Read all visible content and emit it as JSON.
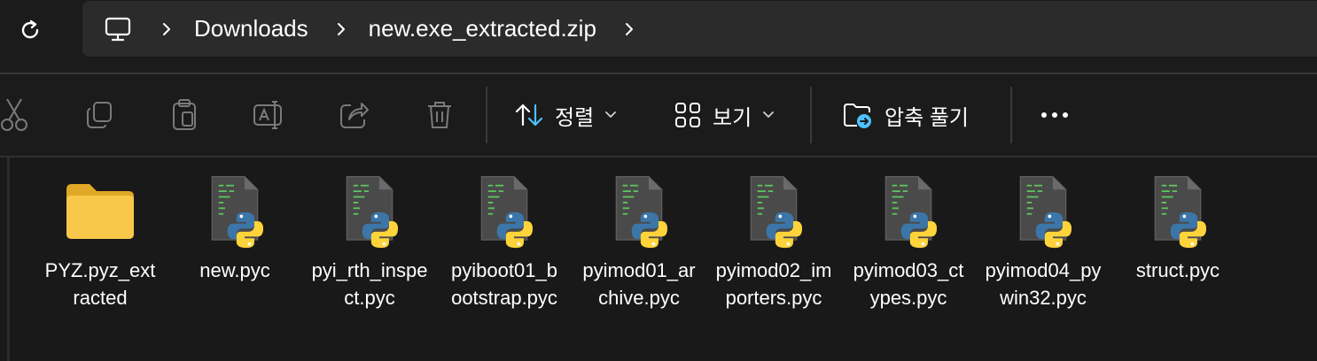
{
  "breadcrumb": {
    "items": [
      "Downloads",
      "new.exe_extracted.zip"
    ]
  },
  "toolbar": {
    "sort_label": "정렬",
    "view_label": "보기",
    "extract_label": "압축 풀기"
  },
  "icons": {
    "refresh": "refresh-icon",
    "pc": "this-pc-icon",
    "cut": "cut-icon",
    "copy": "copy-icon",
    "paste": "paste-icon",
    "rename": "rename-icon",
    "share": "share-icon",
    "delete": "delete-icon",
    "sort": "sort-icon",
    "view": "view-icon",
    "extract": "extract-icon",
    "more": "more-icon"
  },
  "colors": {
    "background": "#1b1b1b",
    "address_bar": "#2b2b2b",
    "folder": "#f8c84a",
    "accent": "#4cc2ff",
    "python_blue": "#3c76a8",
    "python_yellow": "#ffd43b"
  },
  "files": [
    {
      "name": "PYZ.pyz_extracted",
      "type": "folder"
    },
    {
      "name": "new.pyc",
      "type": "pyc"
    },
    {
      "name": "pyi_rth_inspect.pyc",
      "type": "pyc"
    },
    {
      "name": "pyiboot01_bootstrap.pyc",
      "type": "pyc"
    },
    {
      "name": "pyimod01_archive.pyc",
      "type": "pyc"
    },
    {
      "name": "pyimod02_importers.pyc",
      "type": "pyc"
    },
    {
      "name": "pyimod03_ctypes.pyc",
      "type": "pyc"
    },
    {
      "name": "pyimod04_pywin32.pyc",
      "type": "pyc"
    },
    {
      "name": "struct.pyc",
      "type": "pyc"
    }
  ]
}
